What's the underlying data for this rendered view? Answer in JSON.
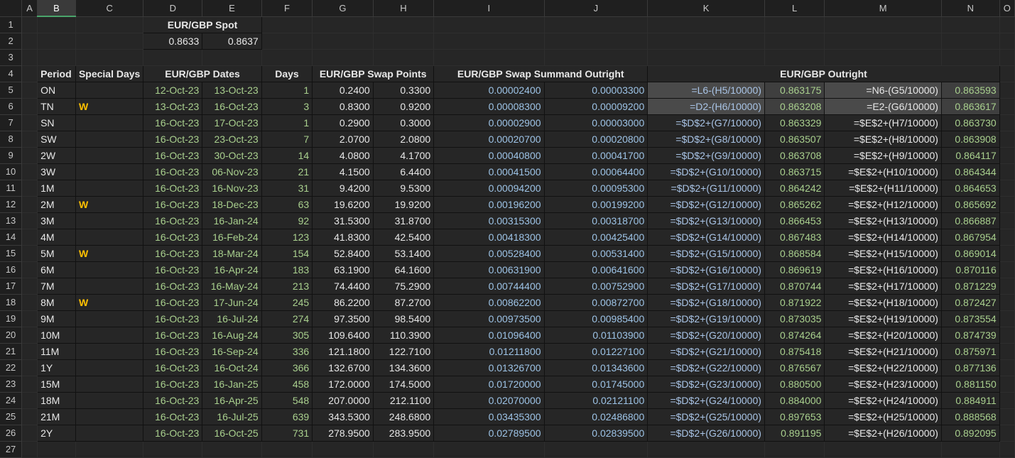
{
  "columns": [
    "A",
    "B",
    "C",
    "D",
    "E",
    "F",
    "G",
    "H",
    "I",
    "J",
    "K",
    "L",
    "M",
    "N",
    "O"
  ],
  "rows": [
    "1",
    "2",
    "3",
    "4",
    "5",
    "6",
    "7",
    "8",
    "9",
    "10",
    "11",
    "12",
    "13",
    "14",
    "15",
    "16",
    "17",
    "18",
    "19",
    "20",
    "21",
    "22",
    "23",
    "24",
    "25",
    "26",
    "27"
  ],
  "spot": {
    "title": "EUR/GBP Spot",
    "bid": "0.8633",
    "ask": "0.8637"
  },
  "headers": {
    "period": "Period",
    "special_days": "Special Days",
    "dates": "EUR/GBP Dates",
    "days": "Days",
    "swap_points": "EUR/GBP Swap Points",
    "swap_summand": "EUR/GBP Swap Summand Outright",
    "outright": "EUR/GBP Outright"
  },
  "data_rows": [
    {
      "period": "ON",
      "special": "",
      "start": "12-Oct-23",
      "end": "13-Oct-23",
      "days": "1",
      "sp_bid": "0.2400",
      "sp_ask": "0.3300",
      "ss_bid": "0.00002400",
      "ss_ask": "0.00003300",
      "f_bid": "=L6-(H5/10000)",
      "o_bid": "0.863175",
      "f_ask": "=N6-(G5/10000)",
      "o_ask": "0.863593"
    },
    {
      "period": "TN",
      "special": "W",
      "start": "13-Oct-23",
      "end": "16-Oct-23",
      "days": "3",
      "sp_bid": "0.8300",
      "sp_ask": "0.9200",
      "ss_bid": "0.00008300",
      "ss_ask": "0.00009200",
      "f_bid": "=D2-(H6/10000)",
      "o_bid": "0.863208",
      "f_ask": "=E2-(G6/10000)",
      "o_ask": "0.863617"
    },
    {
      "period": "SN",
      "special": "",
      "start": "16-Oct-23",
      "end": "17-Oct-23",
      "days": "1",
      "sp_bid": "0.2900",
      "sp_ask": "0.3000",
      "ss_bid": "0.00002900",
      "ss_ask": "0.00003000",
      "f_bid": "=$D$2+(G7/10000)",
      "o_bid": "0.863329",
      "f_ask": "=$E$2+(H7/10000)",
      "o_ask": "0.863730"
    },
    {
      "period": "SW",
      "special": "",
      "start": "16-Oct-23",
      "end": "23-Oct-23",
      "days": "7",
      "sp_bid": "2.0700",
      "sp_ask": "2.0800",
      "ss_bid": "0.00020700",
      "ss_ask": "0.00020800",
      "f_bid": "=$D$2+(G8/10000)",
      "o_bid": "0.863507",
      "f_ask": "=$E$2+(H8/10000)",
      "o_ask": "0.863908"
    },
    {
      "period": "2W",
      "special": "",
      "start": "16-Oct-23",
      "end": "30-Oct-23",
      "days": "14",
      "sp_bid": "4.0800",
      "sp_ask": "4.1700",
      "ss_bid": "0.00040800",
      "ss_ask": "0.00041700",
      "f_bid": "=$D$2+(G9/10000)",
      "o_bid": "0.863708",
      "f_ask": "=$E$2+(H9/10000)",
      "o_ask": "0.864117"
    },
    {
      "period": "3W",
      "special": "",
      "start": "16-Oct-23",
      "end": "06-Nov-23",
      "days": "21",
      "sp_bid": "4.1500",
      "sp_ask": "6.4400",
      "ss_bid": "0.00041500",
      "ss_ask": "0.00064400",
      "f_bid": "=$D$2+(G10/10000)",
      "o_bid": "0.863715",
      "f_ask": "=$E$2+(H10/10000)",
      "o_ask": "0.864344"
    },
    {
      "period": "1M",
      "special": "",
      "start": "16-Oct-23",
      "end": "16-Nov-23",
      "days": "31",
      "sp_bid": "9.4200",
      "sp_ask": "9.5300",
      "ss_bid": "0.00094200",
      "ss_ask": "0.00095300",
      "f_bid": "=$D$2+(G11/10000)",
      "o_bid": "0.864242",
      "f_ask": "=$E$2+(H11/10000)",
      "o_ask": "0.864653"
    },
    {
      "period": "2M",
      "special": "W",
      "start": "16-Oct-23",
      "end": "18-Dec-23",
      "days": "63",
      "sp_bid": "19.6200",
      "sp_ask": "19.9200",
      "ss_bid": "0.00196200",
      "ss_ask": "0.00199200",
      "f_bid": "=$D$2+(G12/10000)",
      "o_bid": "0.865262",
      "f_ask": "=$E$2+(H12/10000)",
      "o_ask": "0.865692"
    },
    {
      "period": "3M",
      "special": "",
      "start": "16-Oct-23",
      "end": "16-Jan-24",
      "days": "92",
      "sp_bid": "31.5300",
      "sp_ask": "31.8700",
      "ss_bid": "0.00315300",
      "ss_ask": "0.00318700",
      "f_bid": "=$D$2+(G13/10000)",
      "o_bid": "0.866453",
      "f_ask": "=$E$2+(H13/10000)",
      "o_ask": "0.866887"
    },
    {
      "period": "4M",
      "special": "",
      "start": "16-Oct-23",
      "end": "16-Feb-24",
      "days": "123",
      "sp_bid": "41.8300",
      "sp_ask": "42.5400",
      "ss_bid": "0.00418300",
      "ss_ask": "0.00425400",
      "f_bid": "=$D$2+(G14/10000)",
      "o_bid": "0.867483",
      "f_ask": "=$E$2+(H14/10000)",
      "o_ask": "0.867954"
    },
    {
      "period": "5M",
      "special": "W",
      "start": "16-Oct-23",
      "end": "18-Mar-24",
      "days": "154",
      "sp_bid": "52.8400",
      "sp_ask": "53.1400",
      "ss_bid": "0.00528400",
      "ss_ask": "0.00531400",
      "f_bid": "=$D$2+(G15/10000)",
      "o_bid": "0.868584",
      "f_ask": "=$E$2+(H15/10000)",
      "o_ask": "0.869014"
    },
    {
      "period": "6M",
      "special": "",
      "start": "16-Oct-23",
      "end": "16-Apr-24",
      "days": "183",
      "sp_bid": "63.1900",
      "sp_ask": "64.1600",
      "ss_bid": "0.00631900",
      "ss_ask": "0.00641600",
      "f_bid": "=$D$2+(G16/10000)",
      "o_bid": "0.869619",
      "f_ask": "=$E$2+(H16/10000)",
      "o_ask": "0.870116"
    },
    {
      "period": "7M",
      "special": "",
      "start": "16-Oct-23",
      "end": "16-May-24",
      "days": "213",
      "sp_bid": "74.4400",
      "sp_ask": "75.2900",
      "ss_bid": "0.00744400",
      "ss_ask": "0.00752900",
      "f_bid": "=$D$2+(G17/10000)",
      "o_bid": "0.870744",
      "f_ask": "=$E$2+(H17/10000)",
      "o_ask": "0.871229"
    },
    {
      "period": "8M",
      "special": "W",
      "start": "16-Oct-23",
      "end": "17-Jun-24",
      "days": "245",
      "sp_bid": "86.2200",
      "sp_ask": "87.2700",
      "ss_bid": "0.00862200",
      "ss_ask": "0.00872700",
      "f_bid": "=$D$2+(G18/10000)",
      "o_bid": "0.871922",
      "f_ask": "=$E$2+(H18/10000)",
      "o_ask": "0.872427"
    },
    {
      "period": "9M",
      "special": "",
      "start": "16-Oct-23",
      "end": "16-Jul-24",
      "days": "274",
      "sp_bid": "97.3500",
      "sp_ask": "98.5400",
      "ss_bid": "0.00973500",
      "ss_ask": "0.00985400",
      "f_bid": "=$D$2+(G19/10000)",
      "o_bid": "0.873035",
      "f_ask": "=$E$2+(H19/10000)",
      "o_ask": "0.873554"
    },
    {
      "period": "10M",
      "special": "",
      "start": "16-Oct-23",
      "end": "16-Aug-24",
      "days": "305",
      "sp_bid": "109.6400",
      "sp_ask": "110.3900",
      "ss_bid": "0.01096400",
      "ss_ask": "0.01103900",
      "f_bid": "=$D$2+(G20/10000)",
      "o_bid": "0.874264",
      "f_ask": "=$E$2+(H20/10000)",
      "o_ask": "0.874739"
    },
    {
      "period": "11M",
      "special": "",
      "start": "16-Oct-23",
      "end": "16-Sep-24",
      "days": "336",
      "sp_bid": "121.1800",
      "sp_ask": "122.7100",
      "ss_bid": "0.01211800",
      "ss_ask": "0.01227100",
      "f_bid": "=$D$2+(G21/10000)",
      "o_bid": "0.875418",
      "f_ask": "=$E$2+(H21/10000)",
      "o_ask": "0.875971"
    },
    {
      "period": "1Y",
      "special": "",
      "start": "16-Oct-23",
      "end": "16-Oct-24",
      "days": "366",
      "sp_bid": "132.6700",
      "sp_ask": "134.3600",
      "ss_bid": "0.01326700",
      "ss_ask": "0.01343600",
      "f_bid": "=$D$2+(G22/10000)",
      "o_bid": "0.876567",
      "f_ask": "=$E$2+(H22/10000)",
      "o_ask": "0.877136"
    },
    {
      "period": "15M",
      "special": "",
      "start": "16-Oct-23",
      "end": "16-Jan-25",
      "days": "458",
      "sp_bid": "172.0000",
      "sp_ask": "174.5000",
      "ss_bid": "0.01720000",
      "ss_ask": "0.01745000",
      "f_bid": "=$D$2+(G23/10000)",
      "o_bid": "0.880500",
      "f_ask": "=$E$2+(H23/10000)",
      "o_ask": "0.881150"
    },
    {
      "period": "18M",
      "special": "",
      "start": "16-Oct-23",
      "end": "16-Apr-25",
      "days": "548",
      "sp_bid": "207.0000",
      "sp_ask": "212.1100",
      "ss_bid": "0.02070000",
      "ss_ask": "0.02121100",
      "f_bid": "=$D$2+(G24/10000)",
      "o_bid": "0.884000",
      "f_ask": "=$E$2+(H24/10000)",
      "o_ask": "0.884911"
    },
    {
      "period": "21M",
      "special": "",
      "start": "16-Oct-23",
      "end": "16-Jul-25",
      "days": "639",
      "sp_bid": "343.5300",
      "sp_ask": "248.6800",
      "ss_bid": "0.03435300",
      "ss_ask": "0.02486800",
      "f_bid": "=$D$2+(G25/10000)",
      "o_bid": "0.897653",
      "f_ask": "=$E$2+(H25/10000)",
      "o_ask": "0.888568"
    },
    {
      "period": "2Y",
      "special": "",
      "start": "16-Oct-23",
      "end": "16-Oct-25",
      "days": "731",
      "sp_bid": "278.9500",
      "sp_ask": "283.9500",
      "ss_bid": "0.02789500",
      "ss_ask": "0.02839500",
      "f_bid": "=$D$2+(G26/10000)",
      "o_bid": "0.891195",
      "f_ask": "=$E$2+(H26/10000)",
      "o_ask": "0.892095"
    }
  ],
  "colors": {
    "green": "#a9d08e",
    "blue": "#9dc3e6",
    "gold": "#ffc000",
    "selected_header": "#4aa56b"
  }
}
